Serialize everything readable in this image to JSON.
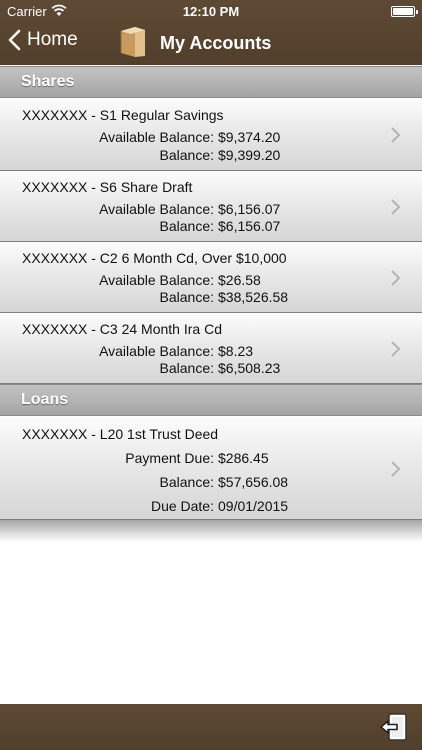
{
  "status": {
    "carrier": "Carrier",
    "time": "12:10 PM"
  },
  "nav": {
    "back_label": "Home",
    "title": "My Accounts",
    "icon": "wallet-icon"
  },
  "shares": {
    "header": "Shares",
    "items": [
      {
        "title": "XXXXXXX - S1 Regular Savings",
        "lines": [
          {
            "label": "Available Balance:",
            "value": "$9,374.20"
          },
          {
            "label": "Balance:",
            "value": "$9,399.20"
          }
        ]
      },
      {
        "title": "XXXXXXX - S6 Share Draft",
        "lines": [
          {
            "label": "Available Balance:",
            "value": "$6,156.07"
          },
          {
            "label": "Balance:",
            "value": "$6,156.07"
          }
        ]
      },
      {
        "title": "XXXXXXX - C2 6 Month Cd, Over $10,000",
        "lines": [
          {
            "label": "Available Balance:",
            "value": "$26.58"
          },
          {
            "label": "Balance:",
            "value": "$38,526.58"
          }
        ]
      },
      {
        "title": "XXXXXXX - C3 24 Month Ira Cd",
        "lines": [
          {
            "label": "Available Balance:",
            "value": "$8.23"
          },
          {
            "label": "Balance:",
            "value": "$6,508.23"
          }
        ]
      }
    ]
  },
  "loans": {
    "header": "Loans",
    "items": [
      {
        "title": "XXXXXXX - L20 1st Trust Deed",
        "lines": [
          {
            "label": "Payment Due:",
            "value": "$286.45"
          },
          {
            "label": "Balance:",
            "value": "$57,656.08"
          },
          {
            "label": "Due Date:",
            "value": "09/01/2015"
          }
        ]
      }
    ]
  },
  "toolbar": {
    "logout_icon": "logout-icon"
  }
}
